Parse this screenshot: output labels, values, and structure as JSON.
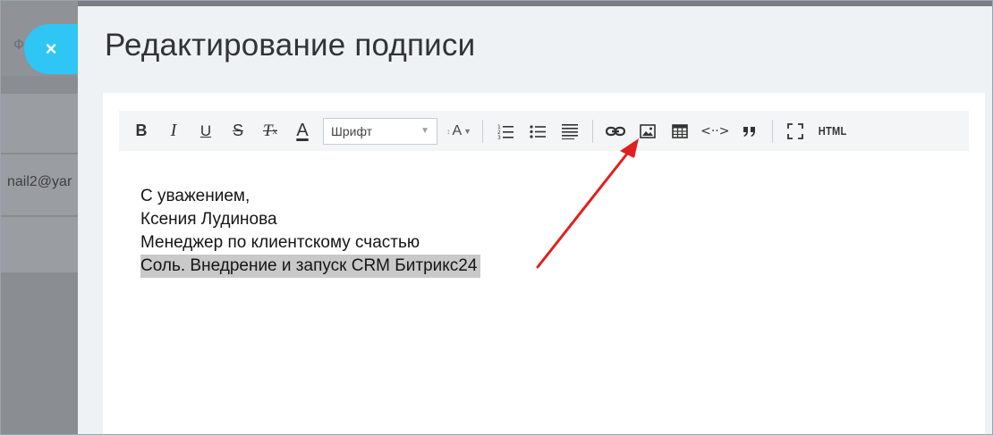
{
  "background": {
    "partial_letter": "Ф",
    "email_fragment": "nail2@yar"
  },
  "close_label": "×",
  "panel": {
    "title": "Редактирование подписи"
  },
  "toolbar": {
    "bold": "B",
    "italic": "I",
    "underline": "U",
    "strike": "S",
    "clear_format": "T",
    "clear_format_sub": "x",
    "font_color": "A",
    "font_select": "Шрифт",
    "font_size": "A",
    "quote": "❞",
    "html": "HTML",
    "code": "<··>"
  },
  "signature": {
    "line1": "С уважением,",
    "line2": "Ксения Лудинова",
    "line3": "Менеджер по клиентскому счастью",
    "line4": "Соль. Внедрение и запуск CRM Битрикс24"
  },
  "colors": {
    "accent": "#2fc6f6",
    "arrow": "#e0201e",
    "selection": "#c9c9c9"
  }
}
